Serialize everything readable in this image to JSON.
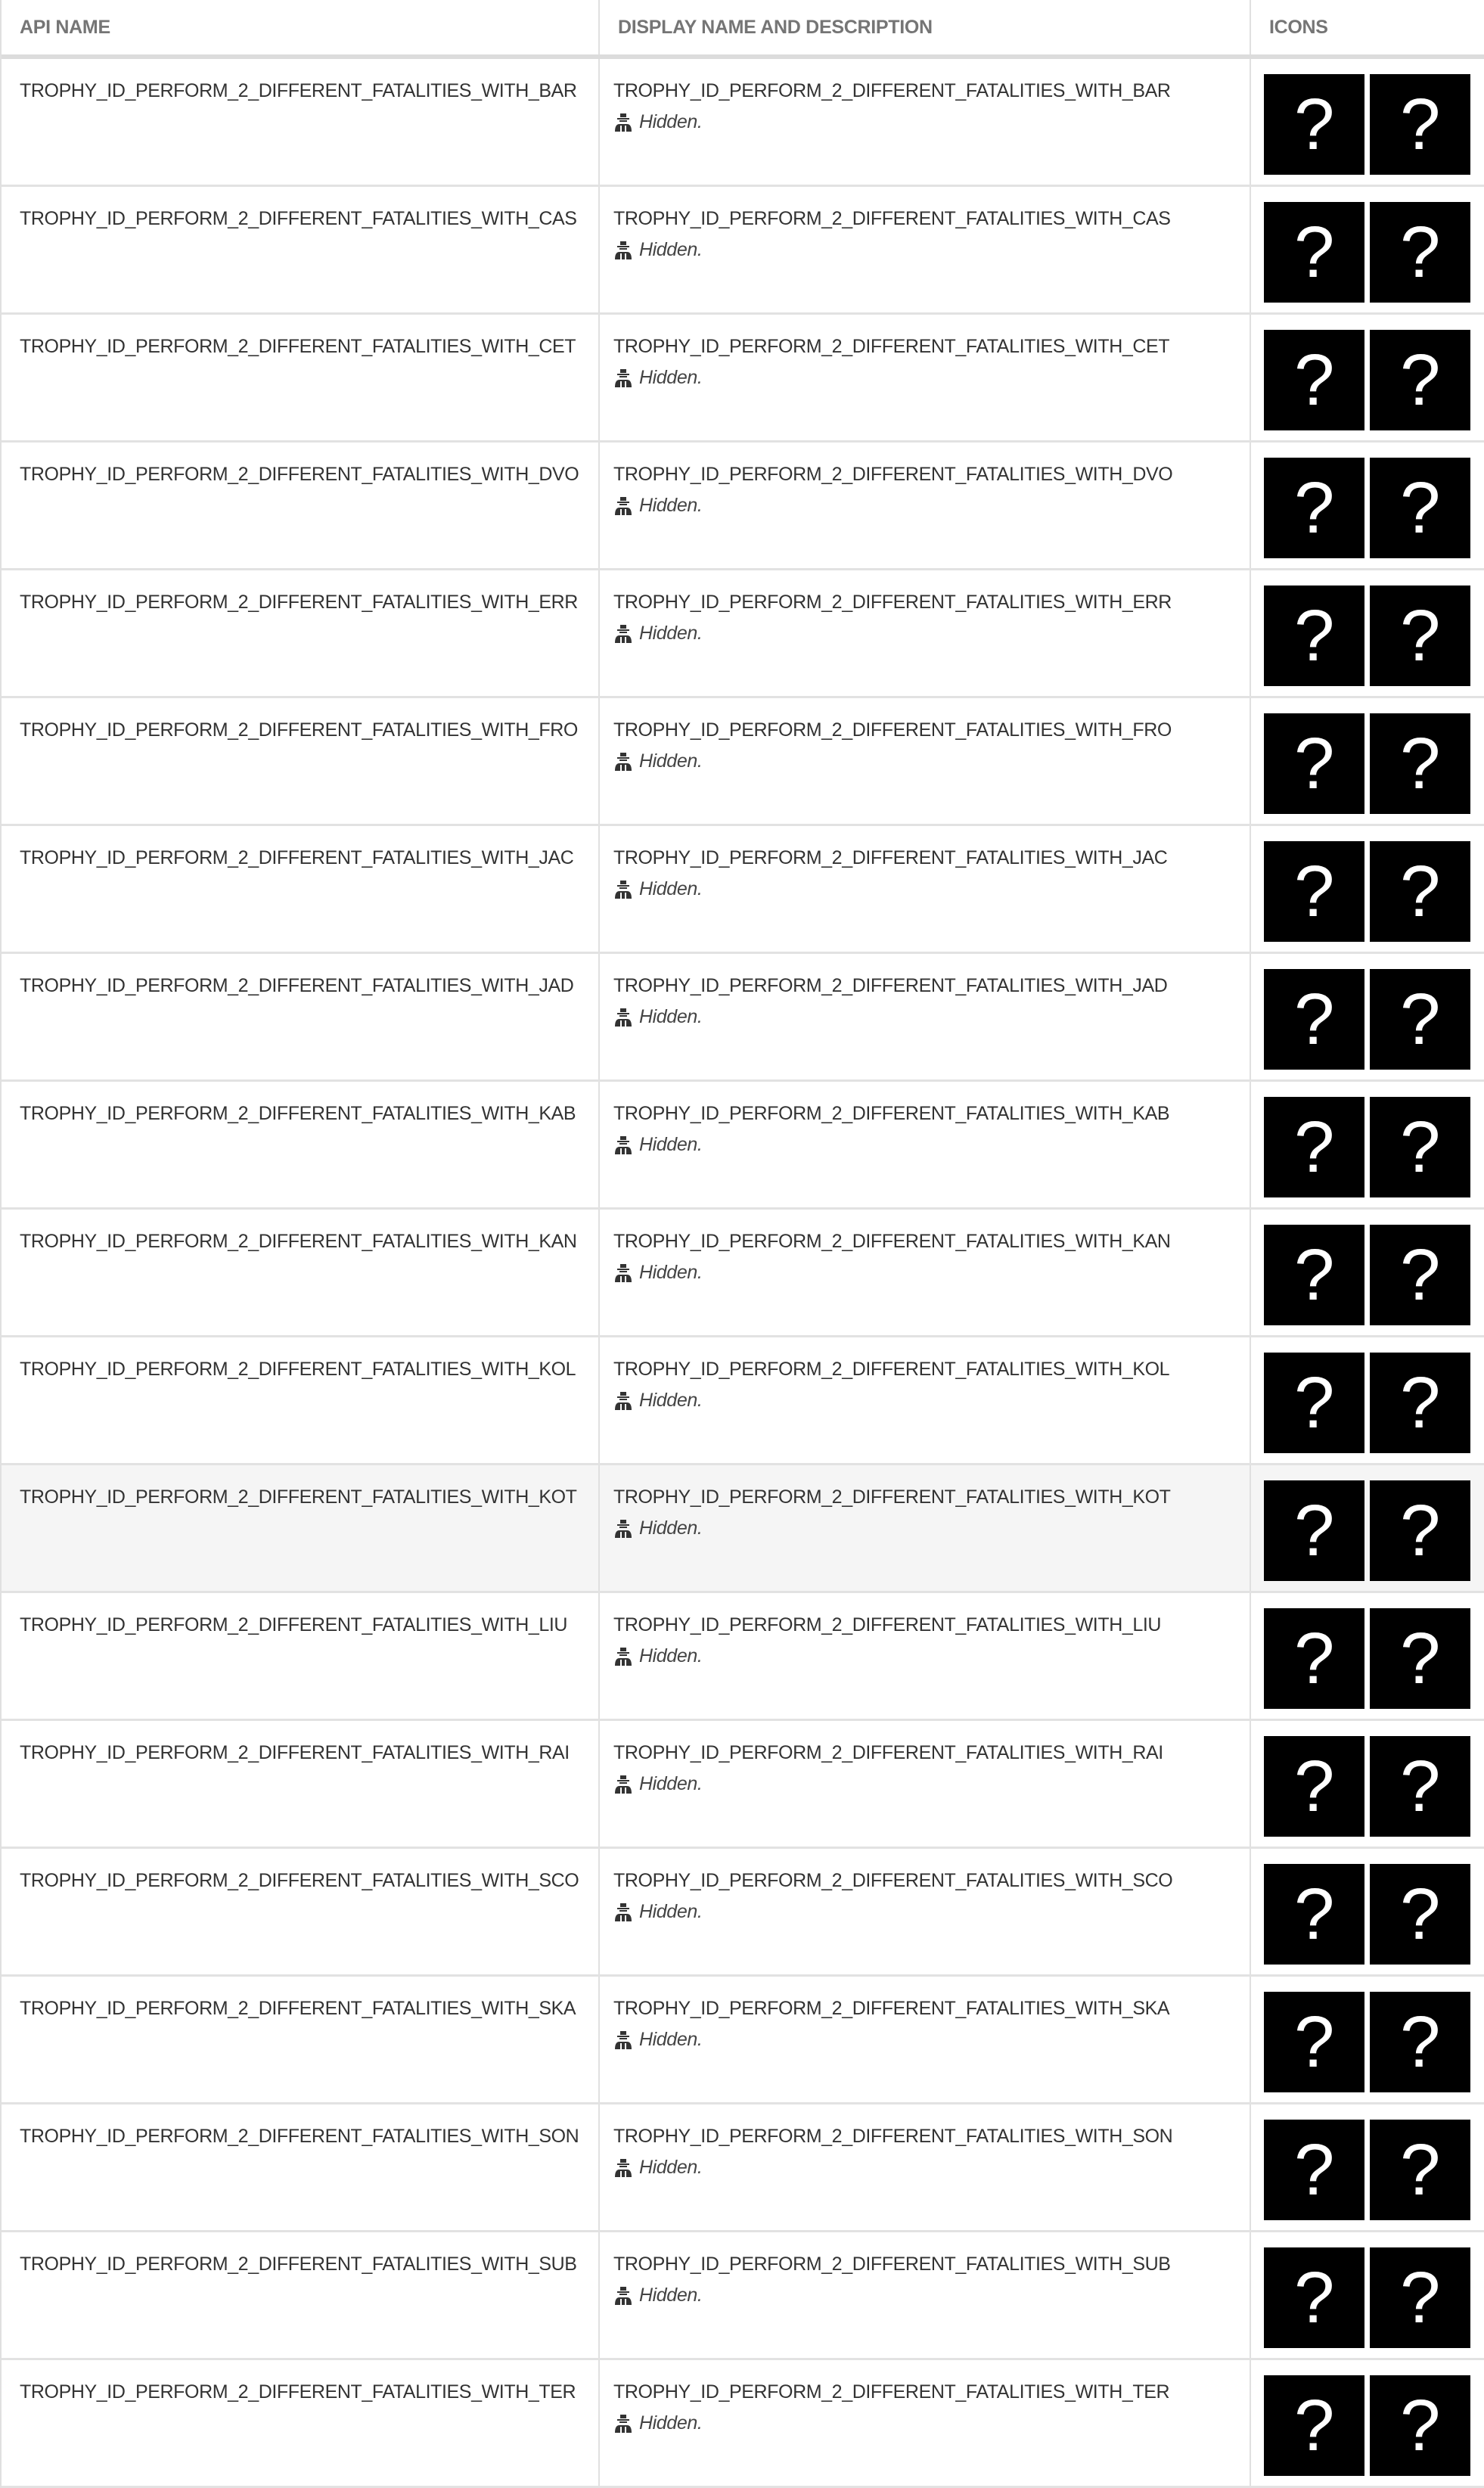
{
  "table": {
    "headers": {
      "api_name": "API NAME",
      "display": "DISPLAY NAME AND DESCRIPTION",
      "icons": "ICONS"
    },
    "rows": [
      {
        "api": "TROPHY_ID_PERFORM_2_DIFFERENT_FATALITIES_WITH_BAR",
        "display": "TROPHY_ID_PERFORM_2_DIFFERENT_FATALITIES_WITH_BAR",
        "desc": "Hidden.",
        "icon_glyph": "?",
        "highlighted": false
      },
      {
        "api": "TROPHY_ID_PERFORM_2_DIFFERENT_FATALITIES_WITH_CAS",
        "display": "TROPHY_ID_PERFORM_2_DIFFERENT_FATALITIES_WITH_CAS",
        "desc": "Hidden.",
        "icon_glyph": "?",
        "highlighted": false
      },
      {
        "api": "TROPHY_ID_PERFORM_2_DIFFERENT_FATALITIES_WITH_CET",
        "display": "TROPHY_ID_PERFORM_2_DIFFERENT_FATALITIES_WITH_CET",
        "desc": "Hidden.",
        "icon_glyph": "?",
        "highlighted": false
      },
      {
        "api": "TROPHY_ID_PERFORM_2_DIFFERENT_FATALITIES_WITH_DVO",
        "display": "TROPHY_ID_PERFORM_2_DIFFERENT_FATALITIES_WITH_DVO",
        "desc": "Hidden.",
        "icon_glyph": "?",
        "highlighted": false
      },
      {
        "api": "TROPHY_ID_PERFORM_2_DIFFERENT_FATALITIES_WITH_ERR",
        "display": "TROPHY_ID_PERFORM_2_DIFFERENT_FATALITIES_WITH_ERR",
        "desc": "Hidden.",
        "icon_glyph": "?",
        "highlighted": false
      },
      {
        "api": "TROPHY_ID_PERFORM_2_DIFFERENT_FATALITIES_WITH_FRO",
        "display": "TROPHY_ID_PERFORM_2_DIFFERENT_FATALITIES_WITH_FRO",
        "desc": "Hidden.",
        "icon_glyph": "?",
        "highlighted": false
      },
      {
        "api": "TROPHY_ID_PERFORM_2_DIFFERENT_FATALITIES_WITH_JAC",
        "display": "TROPHY_ID_PERFORM_2_DIFFERENT_FATALITIES_WITH_JAC",
        "desc": "Hidden.",
        "icon_glyph": "?",
        "highlighted": false
      },
      {
        "api": "TROPHY_ID_PERFORM_2_DIFFERENT_FATALITIES_WITH_JAD",
        "display": "TROPHY_ID_PERFORM_2_DIFFERENT_FATALITIES_WITH_JAD",
        "desc": "Hidden.",
        "icon_glyph": "?",
        "highlighted": false
      },
      {
        "api": "TROPHY_ID_PERFORM_2_DIFFERENT_FATALITIES_WITH_KAB",
        "display": "TROPHY_ID_PERFORM_2_DIFFERENT_FATALITIES_WITH_KAB",
        "desc": "Hidden.",
        "icon_glyph": "?",
        "highlighted": false
      },
      {
        "api": "TROPHY_ID_PERFORM_2_DIFFERENT_FATALITIES_WITH_KAN",
        "display": "TROPHY_ID_PERFORM_2_DIFFERENT_FATALITIES_WITH_KAN",
        "desc": "Hidden.",
        "icon_glyph": "?",
        "highlighted": false
      },
      {
        "api": "TROPHY_ID_PERFORM_2_DIFFERENT_FATALITIES_WITH_KOL",
        "display": "TROPHY_ID_PERFORM_2_DIFFERENT_FATALITIES_WITH_KOL",
        "desc": "Hidden.",
        "icon_glyph": "?",
        "highlighted": false
      },
      {
        "api": "TROPHY_ID_PERFORM_2_DIFFERENT_FATALITIES_WITH_KOT",
        "display": "TROPHY_ID_PERFORM_2_DIFFERENT_FATALITIES_WITH_KOT",
        "desc": "Hidden.",
        "icon_glyph": "?",
        "highlighted": true
      },
      {
        "api": "TROPHY_ID_PERFORM_2_DIFFERENT_FATALITIES_WITH_LIU",
        "display": "TROPHY_ID_PERFORM_2_DIFFERENT_FATALITIES_WITH_LIU",
        "desc": "Hidden.",
        "icon_glyph": "?",
        "highlighted": false
      },
      {
        "api": "TROPHY_ID_PERFORM_2_DIFFERENT_FATALITIES_WITH_RAI",
        "display": "TROPHY_ID_PERFORM_2_DIFFERENT_FATALITIES_WITH_RAI",
        "desc": "Hidden.",
        "icon_glyph": "?",
        "highlighted": false
      },
      {
        "api": "TROPHY_ID_PERFORM_2_DIFFERENT_FATALITIES_WITH_SCO",
        "display": "TROPHY_ID_PERFORM_2_DIFFERENT_FATALITIES_WITH_SCO",
        "desc": "Hidden.",
        "icon_glyph": "?",
        "highlighted": false
      },
      {
        "api": "TROPHY_ID_PERFORM_2_DIFFERENT_FATALITIES_WITH_SKA",
        "display": "TROPHY_ID_PERFORM_2_DIFFERENT_FATALITIES_WITH_SKA",
        "desc": "Hidden.",
        "icon_glyph": "?",
        "highlighted": false
      },
      {
        "api": "TROPHY_ID_PERFORM_2_DIFFERENT_FATALITIES_WITH_SON",
        "display": "TROPHY_ID_PERFORM_2_DIFFERENT_FATALITIES_WITH_SON",
        "desc": "Hidden.",
        "icon_glyph": "?",
        "highlighted": false
      },
      {
        "api": "TROPHY_ID_PERFORM_2_DIFFERENT_FATALITIES_WITH_SUB",
        "display": "TROPHY_ID_PERFORM_2_DIFFERENT_FATALITIES_WITH_SUB",
        "desc": "Hidden.",
        "icon_glyph": "?",
        "highlighted": false
      },
      {
        "api": "TROPHY_ID_PERFORM_2_DIFFERENT_FATALITIES_WITH_TER",
        "display": "TROPHY_ID_PERFORM_2_DIFFERENT_FATALITIES_WITH_TER",
        "desc": "Hidden.",
        "icon_glyph": "?",
        "highlighted": false
      }
    ]
  },
  "colors": {
    "header_text": "#757575",
    "body_text": "#333333",
    "highlight_row": "#f5f5f5",
    "icon_bg": "#000000",
    "icon_fg": "#ffffff"
  }
}
